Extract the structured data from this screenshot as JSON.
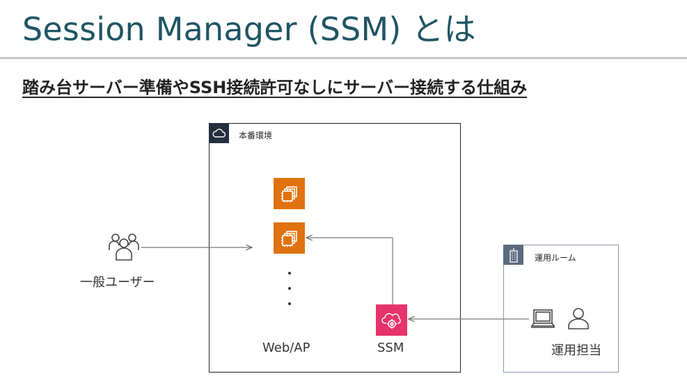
{
  "title": "Session Manager (SSM) とは",
  "subtitle": "踏み台サーバー準備やSSH接続許可なしにサーバー接続する仕組み",
  "production": {
    "label": "本番環境"
  },
  "web_ap": {
    "label": "Web/AP"
  },
  "ssm": {
    "label": "SSM"
  },
  "users": {
    "label": "一般ユーザー"
  },
  "operations": {
    "room_label": "運用ルーム",
    "staff_label": "運用担当"
  },
  "colors": {
    "title": "#1f5563",
    "ec2": "#e0720f",
    "ssm": "#e7336c",
    "cloud_tag": "#232f3e",
    "building_tag": "#5a6b80"
  },
  "icons": [
    "cloud-icon",
    "ec2-instance-icon",
    "users-icon",
    "ssm-icon",
    "building-icon",
    "laptop-icon",
    "user-icon"
  ]
}
